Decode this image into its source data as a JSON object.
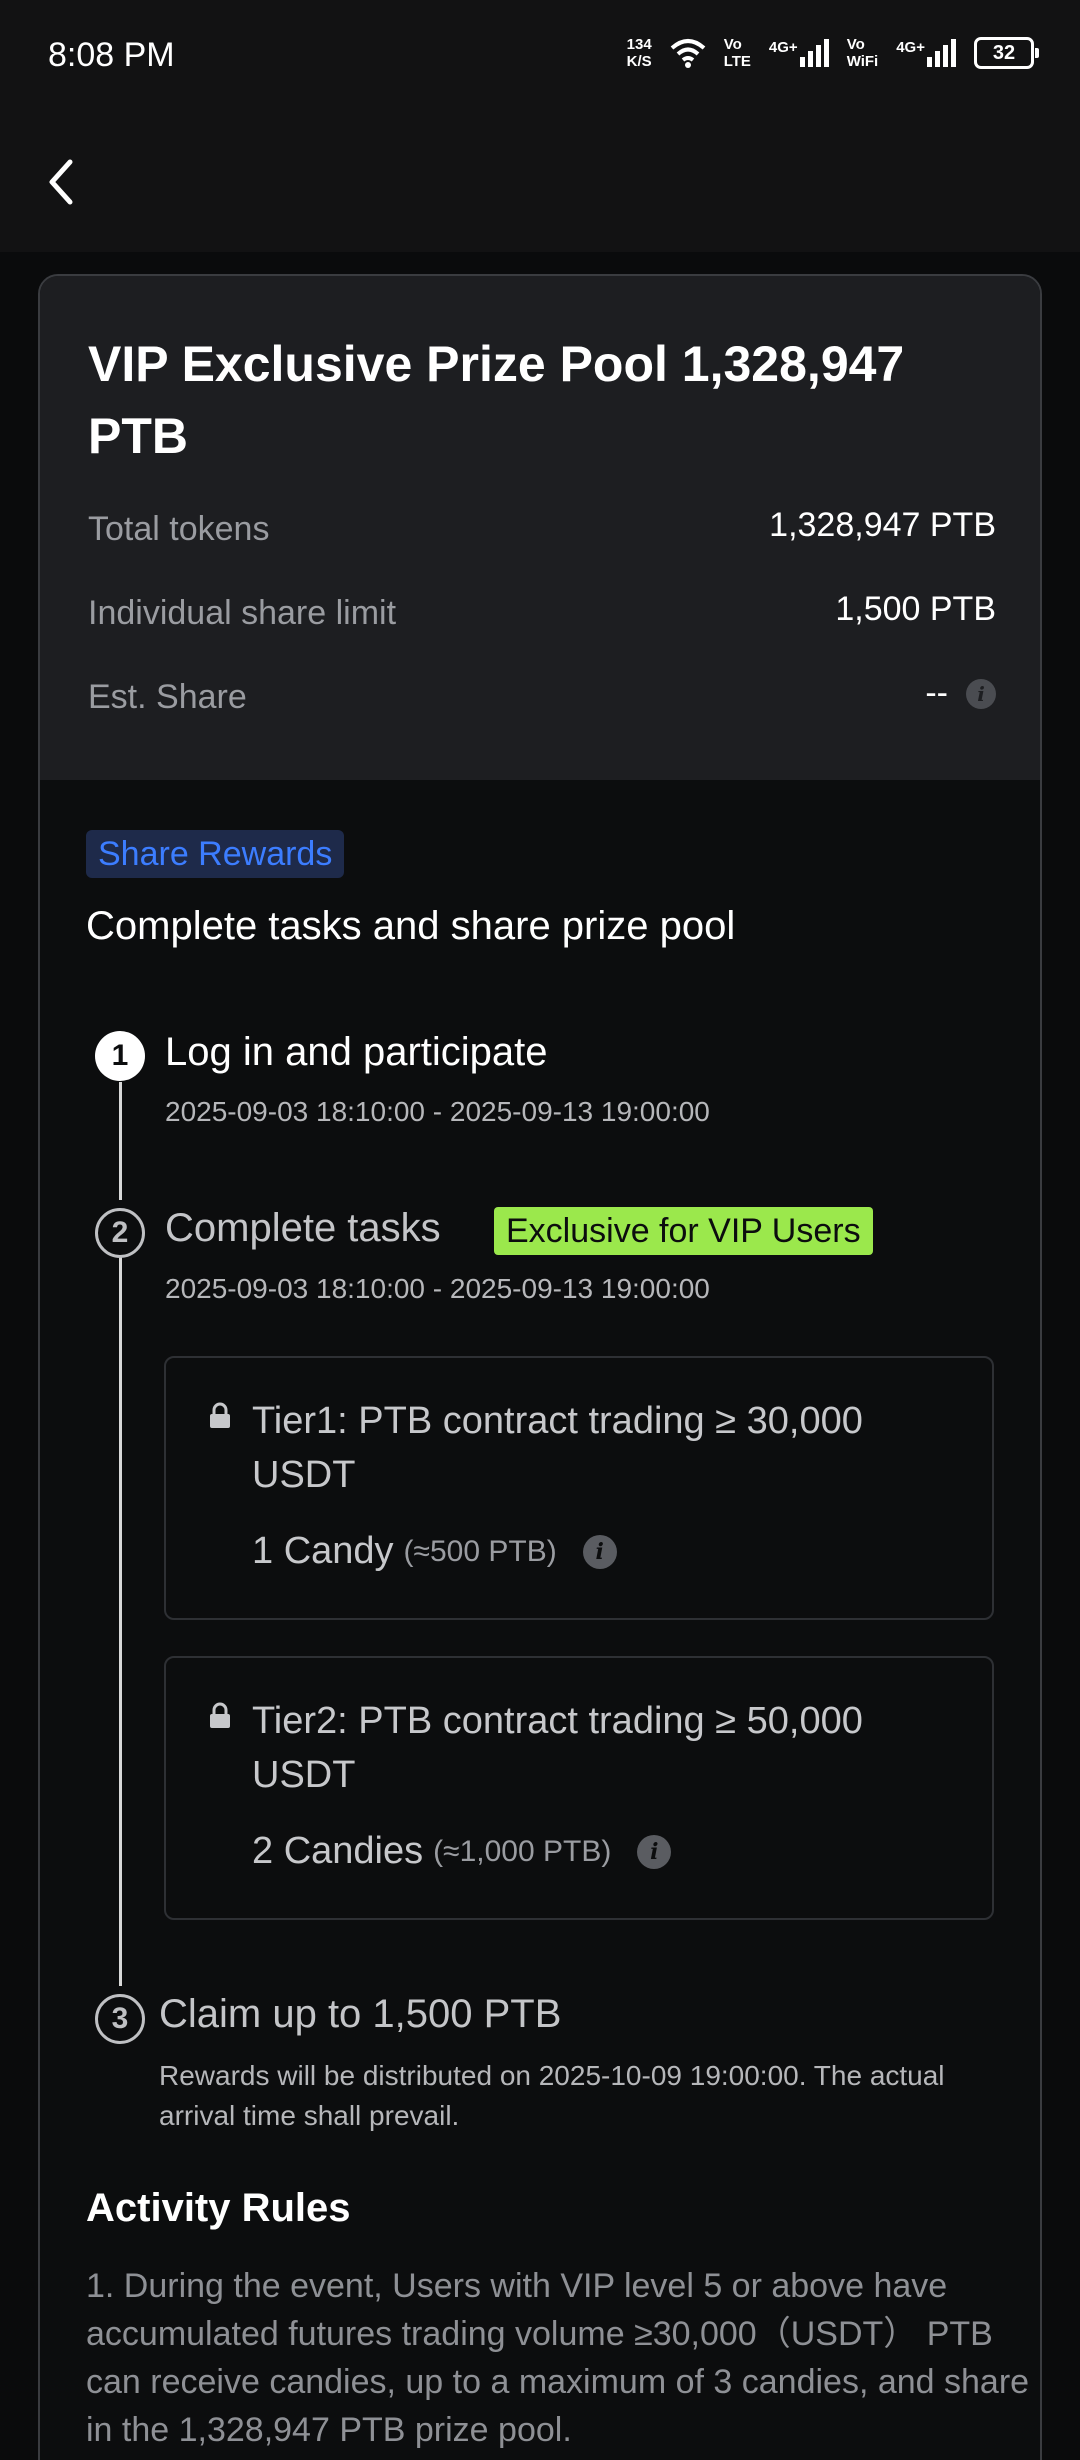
{
  "status_bar": {
    "time": "8:08 PM",
    "speed_value": "134",
    "speed_unit": "K/S",
    "vo_lte_top": "Vo",
    "vo_lte_bottom": "LTE",
    "net1": "4G+",
    "vo_wifi_top": "Vo",
    "vo_wifi_bottom": "WiFi",
    "net2": "4G+",
    "battery": "32"
  },
  "pool": {
    "title": "VIP Exclusive Prize Pool 1,328,947 PTB",
    "stats": [
      {
        "label": "Total tokens",
        "value": "1,328,947 PTB"
      },
      {
        "label": "Individual share limit",
        "value": "1,500 PTB"
      },
      {
        "label": "Est. Share",
        "value": "--"
      }
    ]
  },
  "share": {
    "badge": "Share Rewards",
    "subtitle": "Complete tasks and share prize pool"
  },
  "steps": [
    {
      "num": "1",
      "title": "Log in and participate",
      "time": "2025-09-03 18:10:00 - 2025-09-13 19:00:00"
    },
    {
      "num": "2",
      "title": "Complete tasks",
      "badge": "Exclusive for VIP Users",
      "time": "2025-09-03 18:10:00 - 2025-09-13 19:00:00"
    },
    {
      "num": "3",
      "title": "Claim up to 1,500 PTB",
      "note": "Rewards will be distributed on 2025-10-09 19:00:00. The actual arrival time shall prevail."
    }
  ],
  "tiers": [
    {
      "title": "Tier1: PTB contract trading ≥ 30,000 USDT",
      "reward": "1 Candy",
      "approx": "(≈500 PTB)"
    },
    {
      "title": "Tier2: PTB contract trading ≥ 50,000 USDT",
      "reward": "2 Candies",
      "approx": "(≈1,000 PTB)"
    }
  ],
  "rules": {
    "title": "Activity Rules",
    "text": "1. During the event, Users with VIP level 5 or above have accumulated futures trading volume ≥30,000（USDT） PTB can receive candies, up to a maximum of 3 candies, and share in the 1,328,947 PTB prize pool."
  },
  "icons": {
    "back": "chevron-left-icon",
    "info": "info-icon",
    "lock": "lock-icon"
  },
  "colors": {
    "accent_blue": "#3c7dff",
    "vip_green": "#9be84c"
  }
}
